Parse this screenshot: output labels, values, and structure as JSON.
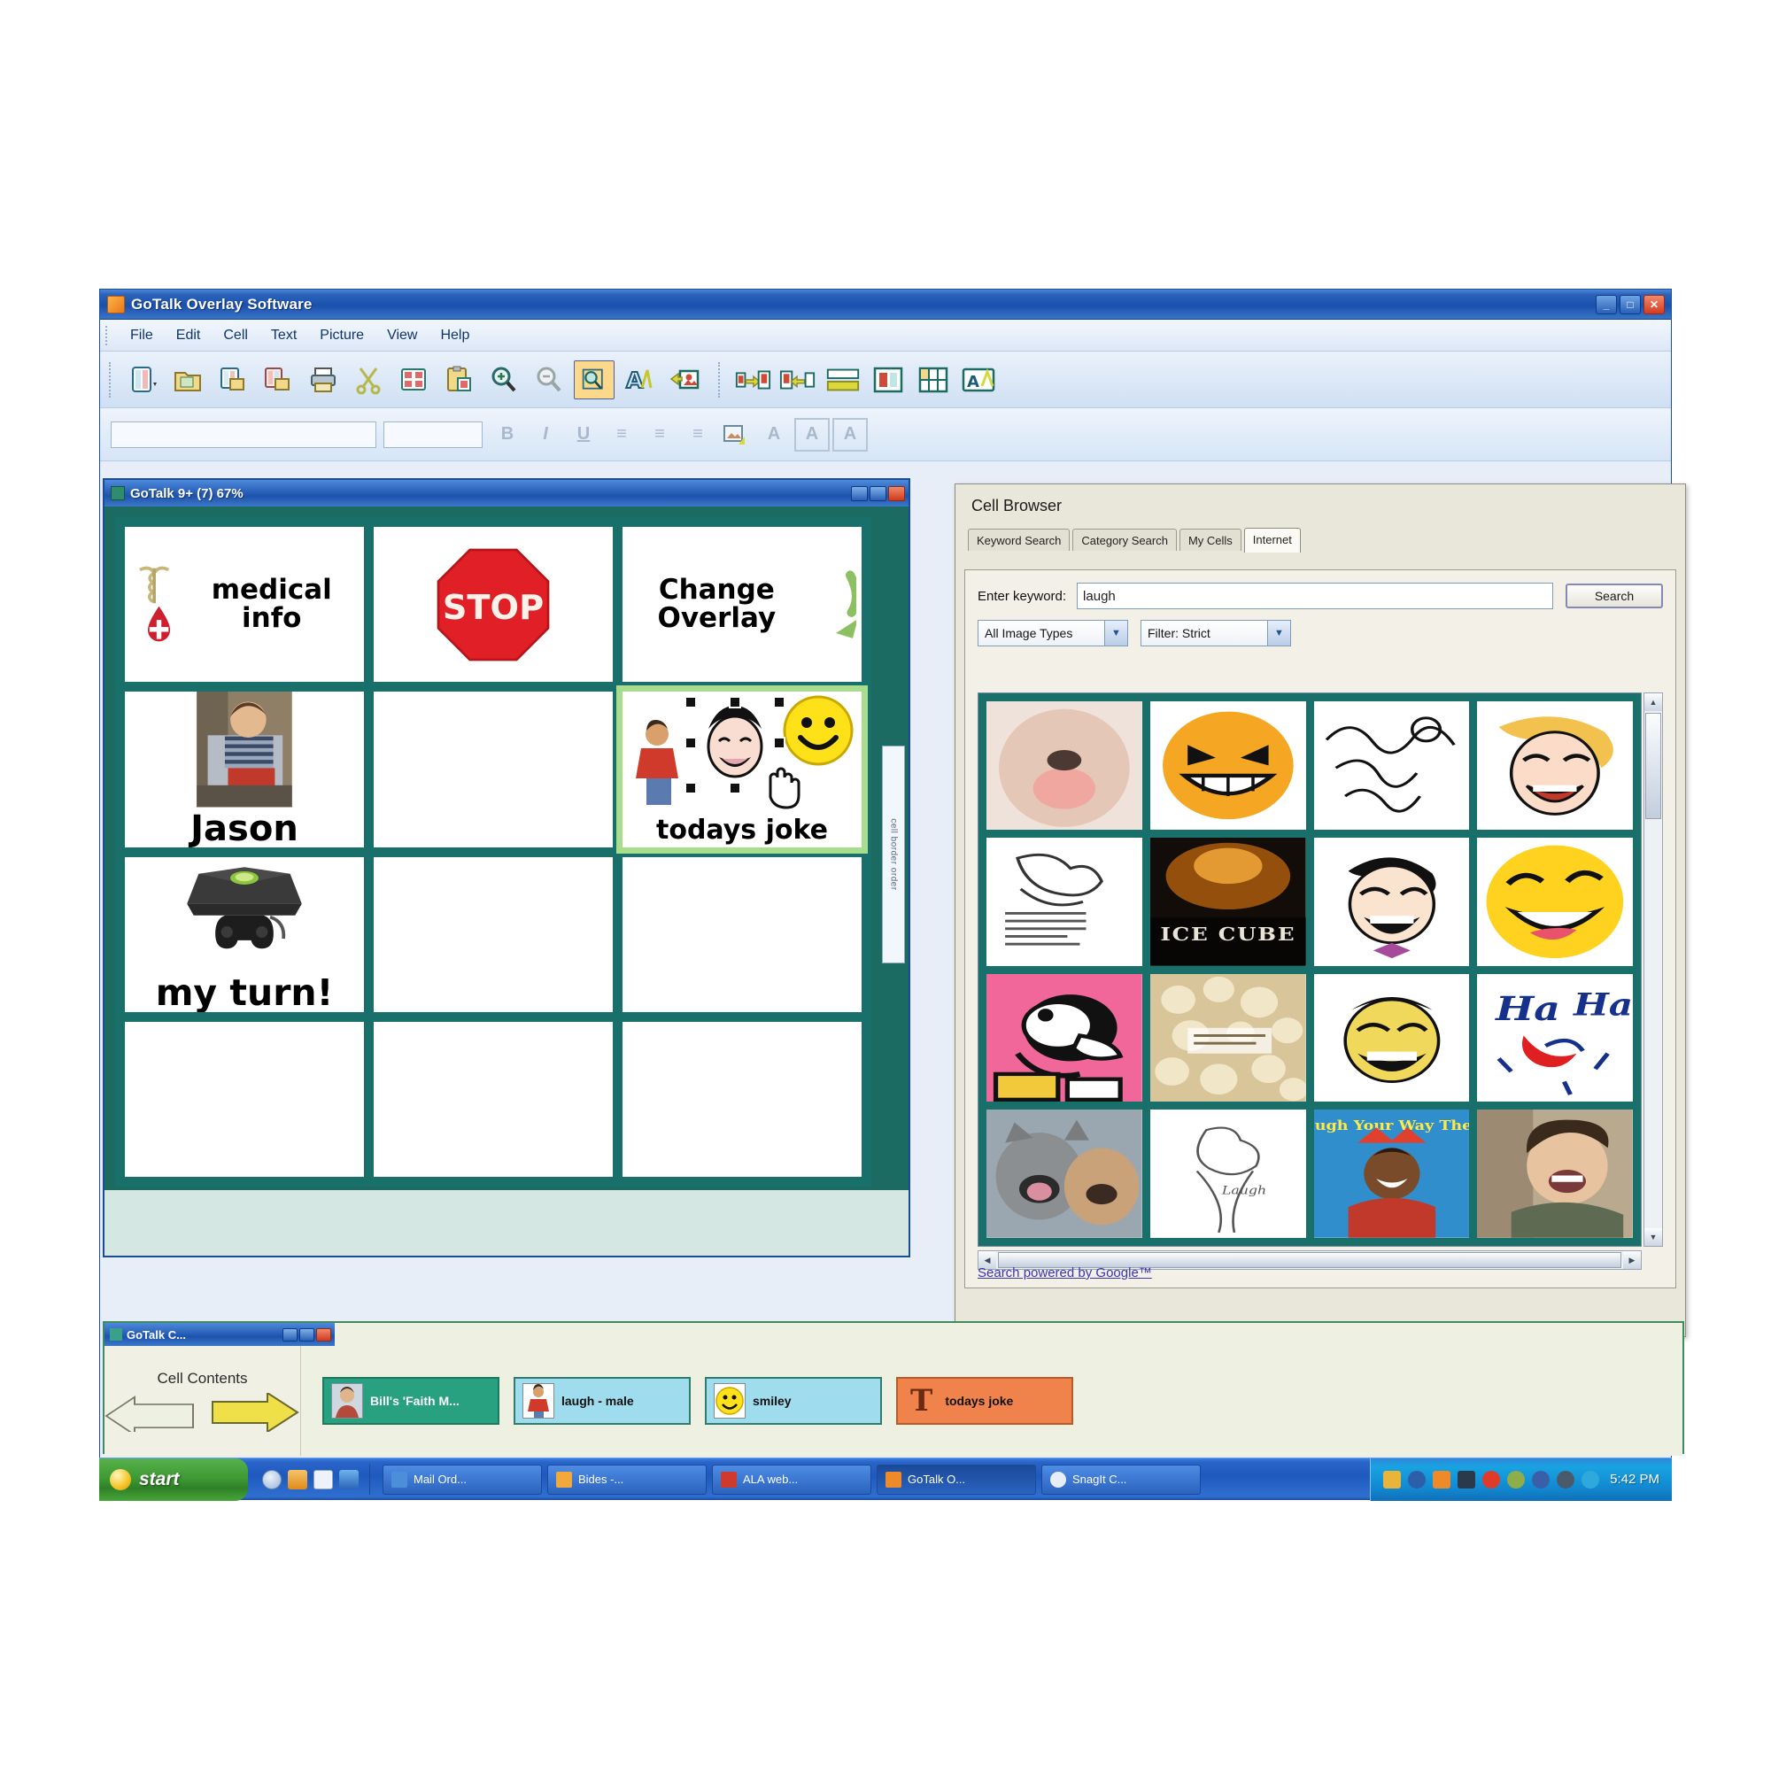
{
  "app": {
    "title": "GoTalk Overlay Software",
    "window_buttons": [
      "_",
      "□",
      "✕"
    ],
    "menu": [
      {
        "label": "File"
      },
      {
        "label": "Edit"
      },
      {
        "label": "Cell"
      },
      {
        "label": "Text"
      },
      {
        "label": "Picture"
      },
      {
        "label": "View"
      },
      {
        "label": "Help"
      }
    ],
    "toolbar": {
      "group1": [
        {
          "name": "new-overlay-icon"
        },
        {
          "name": "open-folder-icon"
        },
        {
          "name": "save-overlay-icon"
        },
        {
          "name": "save-as-icon"
        },
        {
          "name": "print-icon"
        },
        {
          "name": "cut-scissors-icon"
        },
        {
          "name": "copy-cells-icon"
        },
        {
          "name": "paste-cells-icon"
        },
        {
          "name": "zoom-in-icon"
        },
        {
          "name": "zoom-out-icon"
        },
        {
          "name": "cell-browser-icon",
          "active": true
        },
        {
          "name": "text-style-icon"
        },
        {
          "name": "insert-picture-icon"
        }
      ],
      "group2": [
        {
          "name": "move-cell-right-icon"
        },
        {
          "name": "move-cell-left-icon"
        },
        {
          "name": "align-cells-icon"
        },
        {
          "name": "cell-size-icon"
        },
        {
          "name": "cell-grid-icon"
        },
        {
          "name": "overlay-settings-icon"
        }
      ]
    },
    "format_bar": {
      "font_combo_value": "",
      "size_combo_value": "",
      "buttons": [
        "B",
        "I",
        "U",
        "≡",
        "≡",
        "≡",
        "🖼",
        "A",
        "A",
        "A"
      ]
    }
  },
  "overlay_window": {
    "title": "GoTalk 9+ (7)  67%",
    "window_buttons": [
      "_",
      "□",
      "✕"
    ],
    "side_tab_label": "cell border order",
    "grid": {
      "rows": 4,
      "cols": 3,
      "cells": [
        {
          "id": "cell-1",
          "label": "medical info",
          "picture": "caduceus-blood-drop",
          "label_size": 31,
          "layout": "side",
          "empty": false,
          "selected": false
        },
        {
          "id": "cell-2",
          "label": "",
          "picture": "stop-sign",
          "empty": false,
          "selected": false
        },
        {
          "id": "cell-3",
          "label": "Change Overlay",
          "picture": "green-curved-arrow",
          "label_size": 31,
          "layout": "side",
          "empty": false,
          "selected": false
        },
        {
          "id": "cell-4",
          "label": "Jason",
          "picture": "photo-boy-in-chair",
          "label_size": 38,
          "empty": false,
          "selected": false
        },
        {
          "id": "cell-5",
          "label": "",
          "picture": "",
          "empty": true,
          "selected": false
        },
        {
          "id": "cell-6",
          "label": "todays joke",
          "picture": "laughing-man-smiley",
          "label_size": 29,
          "empty": false,
          "selected": true
        },
        {
          "id": "cell-7",
          "label": "my turn!",
          "picture": "xbox-console-controller",
          "label_size": 38,
          "empty": false,
          "selected": false
        },
        {
          "id": "cell-8",
          "label": "",
          "picture": "",
          "empty": true,
          "selected": false
        },
        {
          "id": "cell-9",
          "label": "",
          "picture": "",
          "empty": true,
          "selected": false
        },
        {
          "id": "cell-10",
          "label": "",
          "picture": "",
          "empty": true,
          "selected": false
        },
        {
          "id": "cell-11",
          "label": "",
          "picture": "",
          "empty": true,
          "selected": false
        },
        {
          "id": "cell-12",
          "label": "",
          "picture": "",
          "empty": true,
          "selected": false
        }
      ]
    }
  },
  "cell_browser": {
    "title": "Cell Browser",
    "tabs": [
      {
        "label": "Keyword Search",
        "active": false
      },
      {
        "label": "Category Search",
        "active": false
      },
      {
        "label": "My Cells",
        "active": false
      },
      {
        "label": "Internet",
        "active": true
      }
    ],
    "keyword_label": "Enter keyword:",
    "keyword_value": "laugh",
    "keyword_placeholder": "",
    "search_button": "Search",
    "image_type_select": "All Image Types",
    "filter_select": "Filter: Strict",
    "footer_link": "Search powered by Google™",
    "results": [
      {
        "id": "r1",
        "alt": "puppy-licking-photo"
      },
      {
        "id": "r2",
        "alt": "orange-grinning-emoji"
      },
      {
        "id": "r3",
        "alt": "black-white-scribble-art"
      },
      {
        "id": "r4",
        "alt": "laughing-woman-cartoon"
      },
      {
        "id": "r5",
        "alt": "line-art-dog-sketch"
      },
      {
        "id": "r6",
        "alt": "ice-cube-album-cover"
      },
      {
        "id": "r7",
        "alt": "laughing-man-bowtie"
      },
      {
        "id": "r8",
        "alt": "yellow-laughing-emoji"
      },
      {
        "id": "r9",
        "alt": "pink-cartoon-goofy"
      },
      {
        "id": "r10",
        "alt": "popcorn-photo"
      },
      {
        "id": "r11",
        "alt": "yellow-laughing-caricature"
      },
      {
        "id": "r12",
        "alt": "ha-ha-text-art"
      },
      {
        "id": "r13",
        "alt": "kitten-yawning-photo"
      },
      {
        "id": "r14",
        "alt": "line-art-laugh-sketch"
      },
      {
        "id": "r15",
        "alt": "laugh-your-way-there-poster"
      },
      {
        "id": "r16",
        "alt": "laughing-woman-photo"
      }
    ]
  },
  "contents_window": {
    "title": "GoTalk C...",
    "window_buttons": [
      "_",
      "□",
      "✕"
    ],
    "label": "Cell Contents",
    "nav_back_icon": "left-arrow",
    "nav_forward_icon": "right-arrow",
    "items": [
      {
        "label": "Bill's 'Faith M...",
        "icon": "photo-thumb",
        "style": "first"
      },
      {
        "label": "laugh - male",
        "icon": "person-red-shirt",
        "style": "normal"
      },
      {
        "label": "smiley",
        "icon": "yellow-smiley",
        "style": "normal"
      },
      {
        "label": "todays joke",
        "icon": "text-T",
        "style": "last"
      }
    ]
  },
  "taskbar": {
    "start_label": "start",
    "quick_launch": [
      {
        "name": "ie-icon",
        "color": "#cfd8e8"
      },
      {
        "name": "folder-icon",
        "color": "#f0a93a"
      },
      {
        "name": "outlook-icon",
        "color": "#eaeef6"
      },
      {
        "name": "media-icon",
        "color": "#4c8fd8"
      }
    ],
    "tasks": [
      {
        "label": "Mail Ord...",
        "icon_color": "#4c8fd8",
        "active": false
      },
      {
        "label": "Bides -...",
        "icon_color": "#f0a93a",
        "active": false
      },
      {
        "label": "ALA web...",
        "icon_color": "#d03a2a",
        "active": false
      },
      {
        "label": "GoTalk O...",
        "icon_color": "#ee8a2a",
        "active": true
      },
      {
        "label": "SnagIt C...",
        "icon_color": "#e8eef8",
        "active": false
      }
    ],
    "tray_icons": [
      {
        "name": "shield-icon",
        "color": "#e8b53a"
      },
      {
        "name": "network-icon",
        "color": "#2d5ea8"
      },
      {
        "name": "volume-icon",
        "color": "#ee8a2a"
      },
      {
        "name": "battery-icon",
        "color": "#2b3a4a"
      },
      {
        "name": "sync-icon",
        "color": "#e03a2a"
      },
      {
        "name": "printer-icon",
        "color": "#8fae4a"
      },
      {
        "name": "messenger-icon",
        "color": "#3a5fa8"
      },
      {
        "name": "update-icon",
        "color": "#4a5a6a"
      },
      {
        "name": "clock-icon",
        "color": "#2fa8dc"
      }
    ],
    "clock": "5:42 PM"
  }
}
